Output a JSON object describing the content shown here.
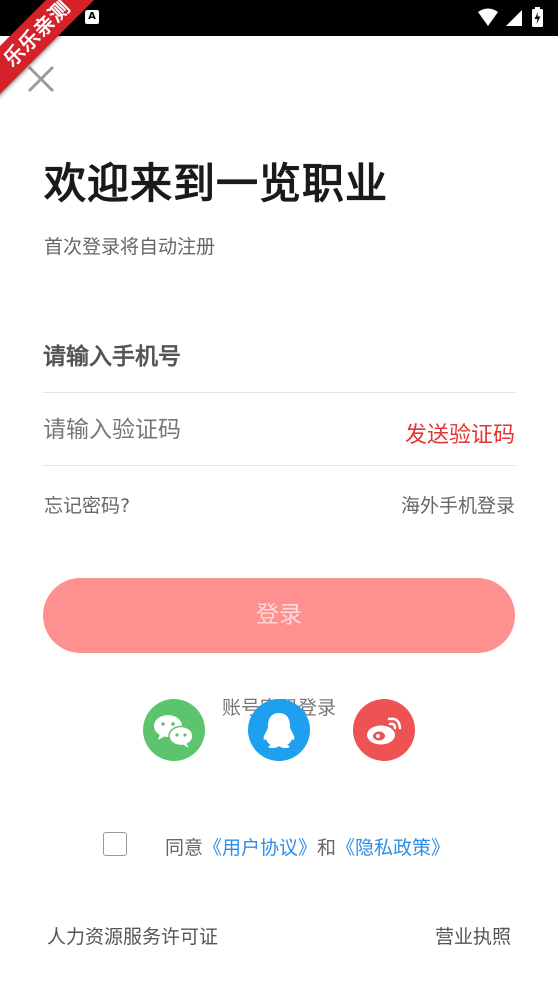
{
  "status_bar": {
    "a_badge": "A",
    "icons": [
      "wifi-icon",
      "signal-icon",
      "battery-charging-icon"
    ]
  },
  "ribbon": {
    "text": "乐乐亲测"
  },
  "close": {
    "icon": "close-icon"
  },
  "welcome": {
    "title": "欢迎来到一览职业",
    "subtitle": "首次登录将自动注册"
  },
  "form": {
    "phone_placeholder": "请输入手机号",
    "code_placeholder": "请输入验证码",
    "send_code_label": "发送验证码",
    "forgot_label": "忘记密码?",
    "overseas_label": "海外手机登录",
    "login_label": "登录"
  },
  "quick_login": {
    "label": "账号密码登录",
    "providers": [
      "wechat-icon",
      "qq-icon",
      "weibo-icon"
    ]
  },
  "agreement": {
    "prefix": "同意",
    "user_agreement": "《用户协议》",
    "and": "和",
    "privacy_policy": "《隐私政策》"
  },
  "footer": {
    "left_link": "人力资源服务许可证",
    "right_link": "营业执照"
  },
  "colors": {
    "accent_red": "#e33434",
    "login_button": "#ff9090",
    "link_blue": "#2f8de4",
    "wechat": "#5cc46c",
    "qq": "#1fa0ee",
    "weibo": "#ef5252",
    "ribbon": "#d4222a"
  }
}
